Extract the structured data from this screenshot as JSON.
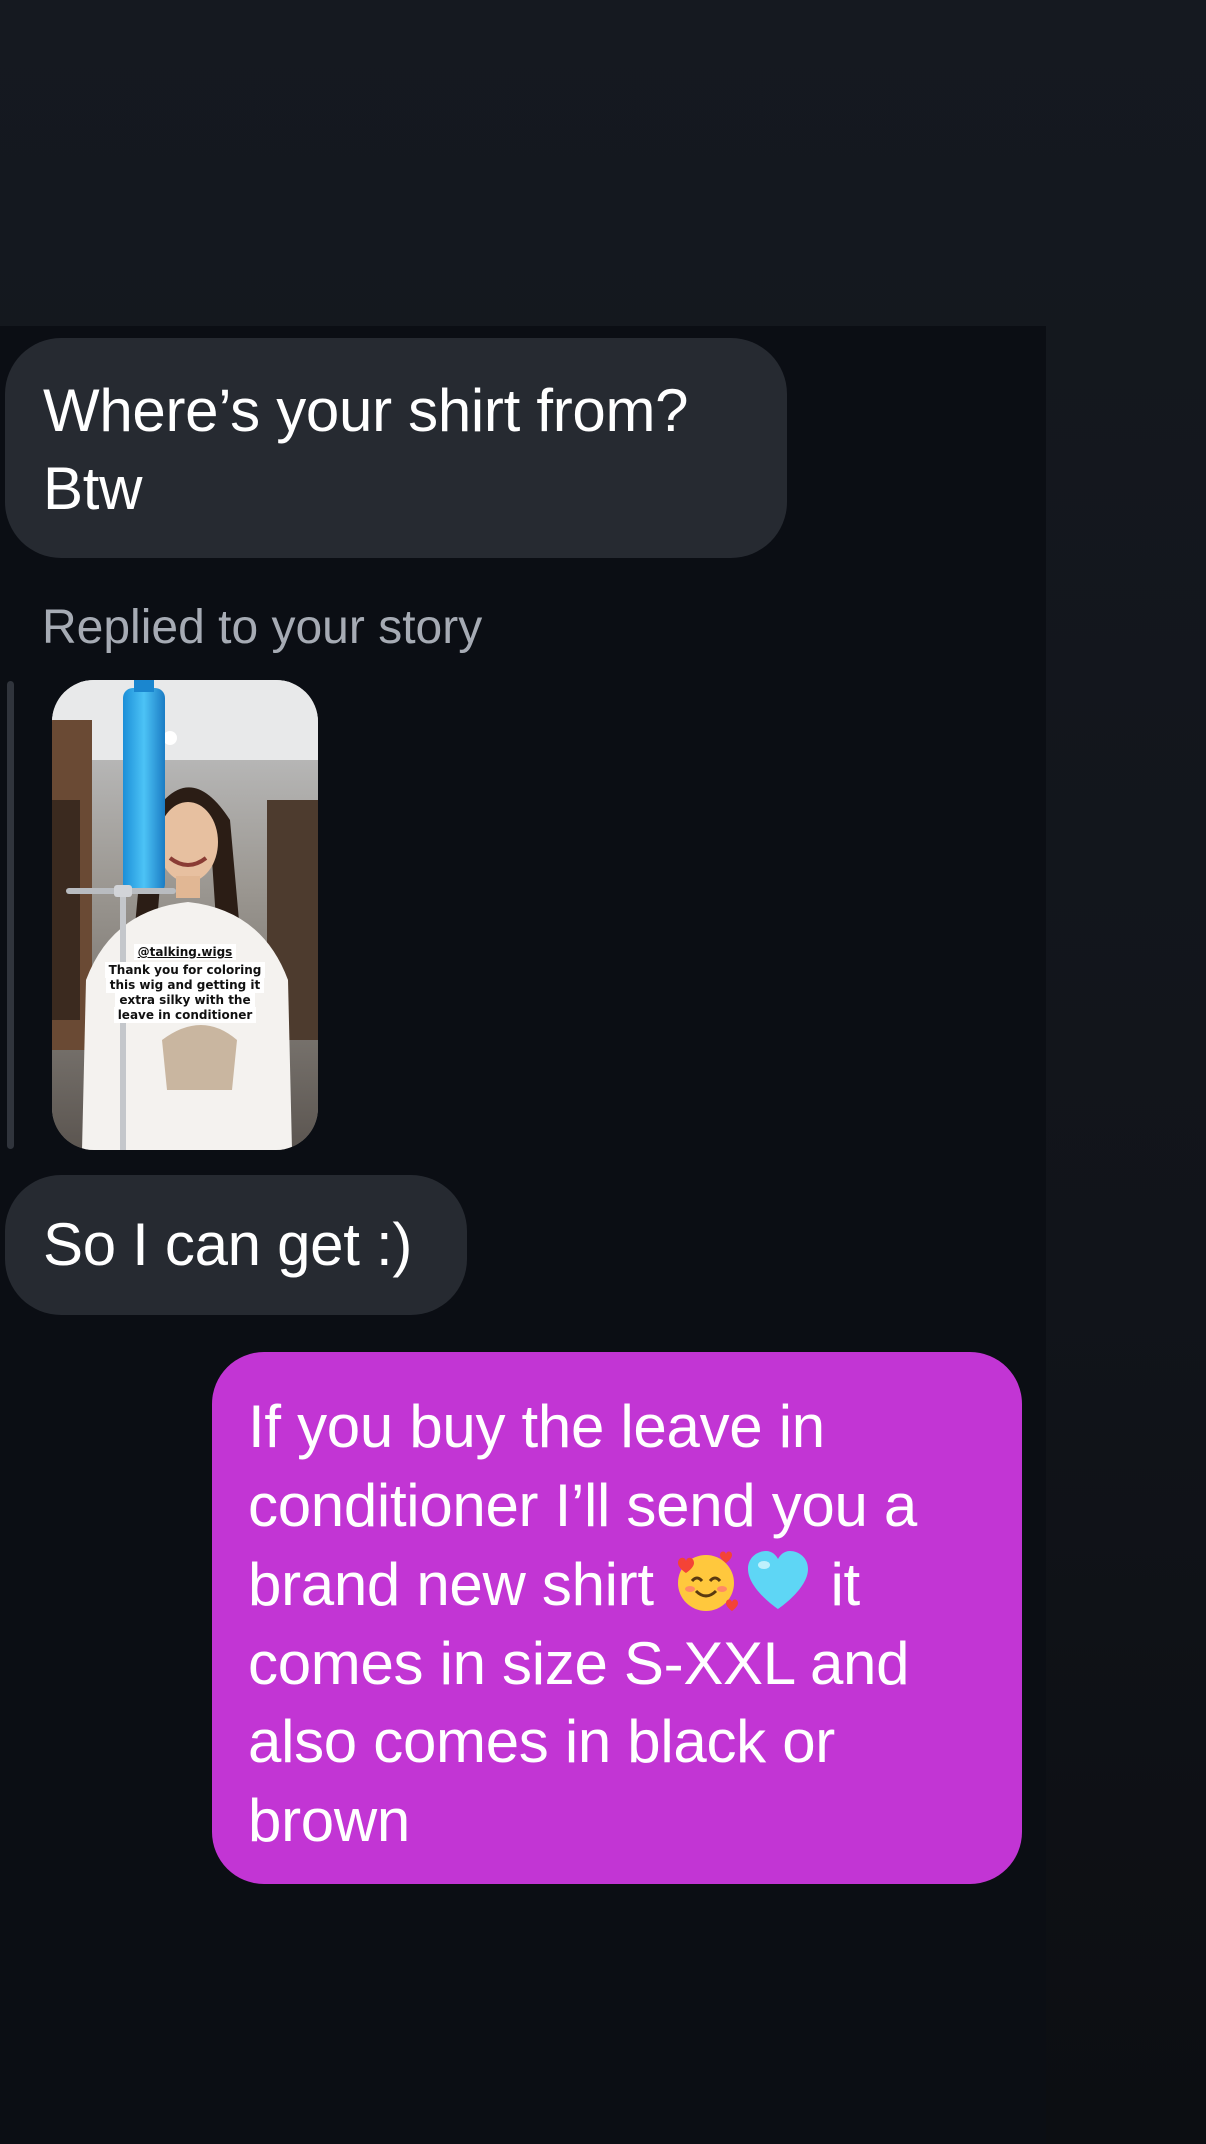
{
  "conversation": {
    "messages": [
      {
        "direction": "incoming",
        "text_line1": "Where’s your shirt from?",
        "text_line2": "Btw"
      },
      {
        "direction": "incoming",
        "story_reply_label": "Replied to your story",
        "story_caption_handle": "@talking.wigs",
        "story_caption_lines": [
          "Thank you for coloring",
          "this wig and getting it",
          "extra silky with the",
          "leave in conditioner"
        ]
      },
      {
        "direction": "incoming",
        "text": "So I can get :)"
      },
      {
        "direction": "outgoing",
        "text_lines": [
          "If you buy the leave in",
          "conditioner I’ll send you a",
          "brand new shirt ",
          " it",
          "comes in size S-XXL and",
          "also comes in black or",
          "brown"
        ],
        "emoji_icons": [
          "smiling-face-with-hearts-icon",
          "light-blue-heart-icon"
        ]
      }
    ]
  },
  "colors": {
    "background": "#13161c",
    "incoming_bubble": "#262a31",
    "outgoing_bubble": "#c235d4",
    "secondary_text": "#a6abb4"
  }
}
